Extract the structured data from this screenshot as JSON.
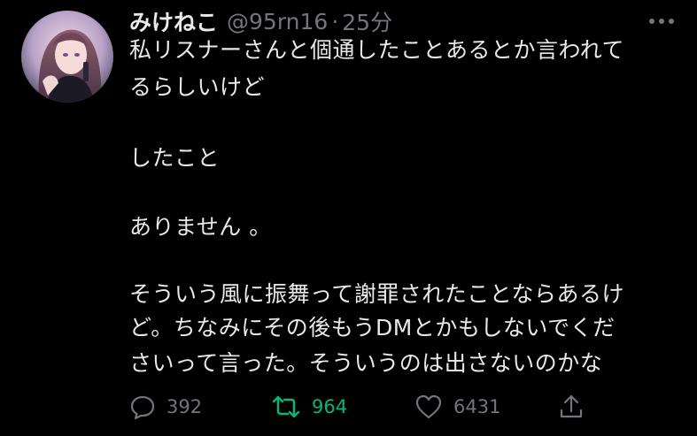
{
  "tweet": {
    "display_name": "みけねこ",
    "handle": "@95rn16",
    "separator": "·",
    "time": "25分",
    "lines": [
      "私リスナーさんと個通したことあるとか言われて",
      "るらしいけど",
      "したこと",
      "ありません 。",
      "そういう風に振舞って謝罪されたことならあるけ",
      "ど。ちなみにその後もうDMとかもしないでくだ",
      "さいって言った。そういうのは出さないのかな"
    ]
  },
  "actions": {
    "reply_count": "392",
    "retweet_count": "964",
    "like_count": "6431"
  },
  "icons": {
    "reply": "reply-icon",
    "retweet": "retweet-icon",
    "like": "heart-icon",
    "share": "share-icon",
    "more": "more-icon"
  },
  "colors": {
    "background": "#000000",
    "text": "#e7e9ea",
    "muted": "#71767b",
    "retweet_active": "#00ba7c"
  }
}
